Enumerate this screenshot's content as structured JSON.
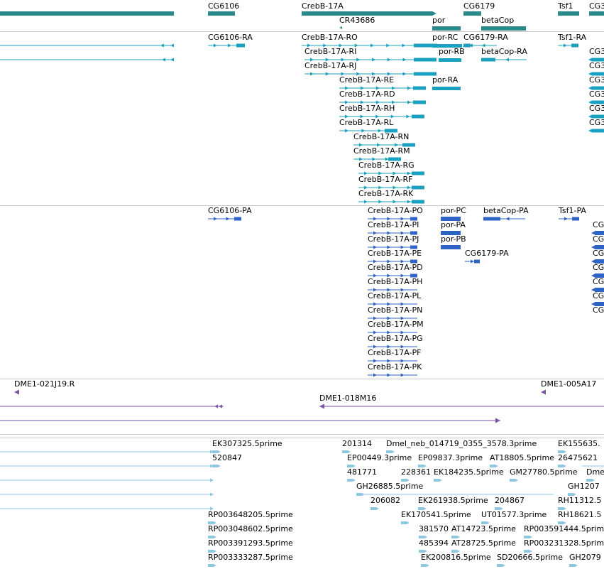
{
  "colors": {
    "gene": "#2a8a8a",
    "rna": "#1aa0c0",
    "protein": "#2f63c6",
    "clone": "#7a55a8",
    "est": "#8fc6e0",
    "separator": "#c8c8c8"
  },
  "tracks": {
    "genes": [
      {
        "label": "CG6106"
      },
      {
        "label": "CrebB-17A"
      },
      {
        "label": "CR43686"
      },
      {
        "label": "por"
      },
      {
        "label": "CG6179"
      },
      {
        "label": "betaCop"
      },
      {
        "label": "Tsf1"
      },
      {
        "label": "CG3"
      }
    ],
    "transcripts": [
      {
        "label": "CG6106-RA"
      },
      {
        "label": "CrebB-17A-RO"
      },
      {
        "label": "por-RC"
      },
      {
        "label": "CG6179-RA"
      },
      {
        "label": "Tsf1-RA"
      },
      {
        "label": "CrebB-17A-RI"
      },
      {
        "label": "por-RB"
      },
      {
        "label": "betaCop-RA"
      },
      {
        "label": "CG3"
      },
      {
        "label": "CrebB-17A-RJ"
      },
      {
        "label": "CG3"
      },
      {
        "label": "CrebB-17A-RE"
      },
      {
        "label": "por-RA"
      },
      {
        "label": "CG3"
      },
      {
        "label": "CrebB-17A-RD"
      },
      {
        "label": "CG3"
      },
      {
        "label": "CrebB-17A-RH"
      },
      {
        "label": "CG3"
      },
      {
        "label": "CrebB-17A-RL"
      },
      {
        "label": "CG3"
      },
      {
        "label": "CrebB-17A-RN"
      },
      {
        "label": "CrebB-17A-RM"
      },
      {
        "label": "CrebB-17A-RG"
      },
      {
        "label": "CrebB-17A-RF"
      },
      {
        "label": "CrebB-17A-RK"
      }
    ],
    "proteins": [
      {
        "label": "CG6106-PA"
      },
      {
        "label": "CrebB-17A-PO"
      },
      {
        "label": "por-PC"
      },
      {
        "label": "betaCop-PA"
      },
      {
        "label": "Tsf1-PA"
      },
      {
        "label": "CG"
      },
      {
        "label": "CrebB-17A-PI"
      },
      {
        "label": "por-PA"
      },
      {
        "label": "CG"
      },
      {
        "label": "CrebB-17A-PJ"
      },
      {
        "label": "por-PB"
      },
      {
        "label": "CG"
      },
      {
        "label": "CrebB-17A-PE"
      },
      {
        "label": "CG6179-PA"
      },
      {
        "label": "CG"
      },
      {
        "label": "CrebB-17A-PD"
      },
      {
        "label": "CG"
      },
      {
        "label": "CrebB-17A-PH"
      },
      {
        "label": "CG"
      },
      {
        "label": "CrebB-17A-PL"
      },
      {
        "label": "CG"
      },
      {
        "label": "CrebB-17A-PN"
      },
      {
        "label": "CrebB-17A-PM"
      },
      {
        "label": "CrebB-17A-PG"
      },
      {
        "label": "CrebB-17A-PF"
      },
      {
        "label": "CrebB-17A-PK"
      }
    ],
    "clones": [
      {
        "label": "DME1-021J19.R"
      },
      {
        "label": "DME1-005A17"
      },
      {
        "label": "DME1-018M16"
      }
    ],
    "ests": [
      {
        "label": "EK307325.5prime"
      },
      {
        "label": "201314"
      },
      {
        "label": "Dmel_neb_014719_0355_3578.3prime"
      },
      {
        "label": "EK155635."
      },
      {
        "label": "520847"
      },
      {
        "label": "EP00449.3prime"
      },
      {
        "label": "EP09837.3prime"
      },
      {
        "label": "AT18805.5prime"
      },
      {
        "label": "26475621"
      },
      {
        "label": "481771"
      },
      {
        "label": "228361"
      },
      {
        "label": "EK184235.5prime"
      },
      {
        "label": "GM27780.5prime"
      },
      {
        "label": "Dme"
      },
      {
        "label": "GH26885.5prime"
      },
      {
        "label": "GH1207"
      },
      {
        "label": "206082"
      },
      {
        "label": "EK261938.5prime"
      },
      {
        "label": "204867"
      },
      {
        "label": "RH11312.5"
      },
      {
        "label": "RP003648205.5prime"
      },
      {
        "label": "EK170541.5prime"
      },
      {
        "label": "UT01577.3prime"
      },
      {
        "label": "RH18621.5"
      },
      {
        "label": "RP003048602.5prime"
      },
      {
        "label": "381570"
      },
      {
        "label": "AT14723.5prime"
      },
      {
        "label": "RP003591444.5prime"
      },
      {
        "label": "RP003391293.5prime"
      },
      {
        "label": "485394"
      },
      {
        "label": "AT28725.5prime"
      },
      {
        "label": "RP003231328.5prime"
      },
      {
        "label": "RP003333287.5prime"
      },
      {
        "label": "EK200816.5prime"
      },
      {
        "label": "SD20666.5prime"
      },
      {
        "label": "GH2079"
      }
    ]
  }
}
